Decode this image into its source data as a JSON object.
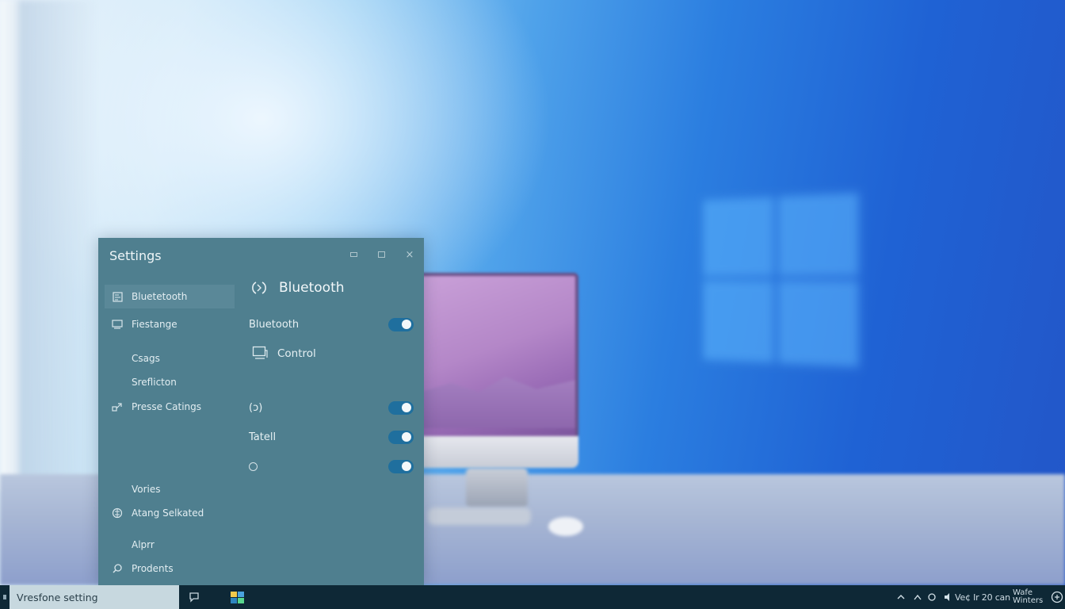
{
  "window": {
    "title": "Settings",
    "controls": {
      "minimize": "minimize",
      "maximize": "maximize",
      "close": "×"
    }
  },
  "sidebar": {
    "items": [
      {
        "label": "Bluetetooth",
        "icon": "bluetooth-device-icon",
        "active": true
      },
      {
        "label": "Fiestange",
        "icon": "display-icon",
        "active": false
      },
      {
        "label": "Csags",
        "icon": null,
        "active": false
      },
      {
        "label": "Sreflicton",
        "icon": null,
        "active": false
      },
      {
        "label": "Presse Catings",
        "icon": "link-icon",
        "active": false
      },
      {
        "label": "Vories",
        "icon": null,
        "active": false
      },
      {
        "label": "Atang Selkated",
        "icon": "globe-icon",
        "active": false
      },
      {
        "label": "Alprr",
        "icon": null,
        "active": false
      },
      {
        "label": "Prodents",
        "icon": "search-icon",
        "active": false
      }
    ]
  },
  "content": {
    "header": {
      "icon": "bluetooth-sync-icon",
      "title": "Bluetooth"
    },
    "bluetooth_row": {
      "label": "Bluetooth",
      "enabled": true
    },
    "control_row": {
      "icon": "monitor-icon",
      "label": "Control"
    },
    "toggle_rows": [
      {
        "label": "(ↄ)",
        "enabled": true
      },
      {
        "label": "Tatell",
        "enabled": true
      },
      {
        "label": "",
        "icon": "circle-icon",
        "enabled": true
      }
    ]
  },
  "taskbar": {
    "search_text": "Vresfone setting",
    "clock": "Ve¢ Ir 20 can",
    "notice_line1": "Wafe",
    "notice_line2": "Winters"
  },
  "colors": {
    "window_bg": "#4f7f8f",
    "toggle_on": "#1f6f9e",
    "taskbar_bg": "#0e2836",
    "search_bg": "#c7d8df"
  }
}
